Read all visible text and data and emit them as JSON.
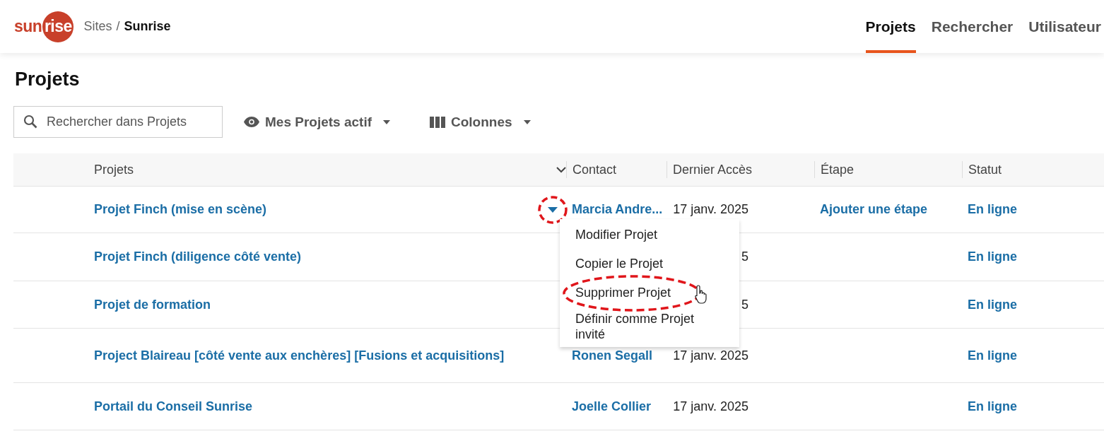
{
  "header": {
    "logo": "sunrise",
    "breadcrumb": [
      {
        "label": "Sites",
        "current": false
      },
      {
        "label": "Sunrise",
        "current": true
      }
    ],
    "separator": "/",
    "nav": [
      {
        "label": "Projets",
        "selected": true
      },
      {
        "label": "Rechercher",
        "selected": false
      },
      {
        "label": "Utilisateur",
        "selected": false
      }
    ]
  },
  "page_title": "Projets",
  "toolbar": {
    "search": {
      "placeholder": "Rechercher dans Projets"
    },
    "filter": "Mes Projets actif",
    "columns": "Colonnes"
  },
  "table": {
    "columns": [
      "Projets",
      "Contact",
      "Dernier Accès",
      "Étape",
      "Statut"
    ],
    "rows": [
      {
        "project": "Projet Finch (mise en scène)",
        "menu_open": true,
        "contact": "Marcia Andre...",
        "date": "17 janv. 2025",
        "stage": "Ajouter une étape",
        "status": "En ligne"
      },
      {
        "project": "Projet Finch (diligence côté vente)",
        "menu_open": false,
        "date": "5",
        "status": "En ligne"
      },
      {
        "project": "Projet de formation",
        "menu_open": false,
        "date": "5",
        "status": "En ligne"
      },
      {
        "project": "Project Blaireau [côté vente aux enchères] [Fusions et acquisitions]",
        "menu_open": false,
        "contact": "Ronen Segall",
        "date": "17 janv. 2025",
        "status": "En ligne"
      },
      {
        "project": "Portail du Conseil Sunrise",
        "menu_open": false,
        "contact": "Joelle Collier",
        "date": "17 janv. 2025",
        "status": "En ligne"
      }
    ]
  },
  "row_menu": {
    "items": [
      {
        "label": "Modifier Projet",
        "annotated": false
      },
      {
        "label": "Copier le Projet",
        "annotated": false
      },
      {
        "label": "Supprimer Projet",
        "annotated": true
      },
      {
        "label": "Définir comme Projet invité",
        "annotated": false
      }
    ]
  }
}
